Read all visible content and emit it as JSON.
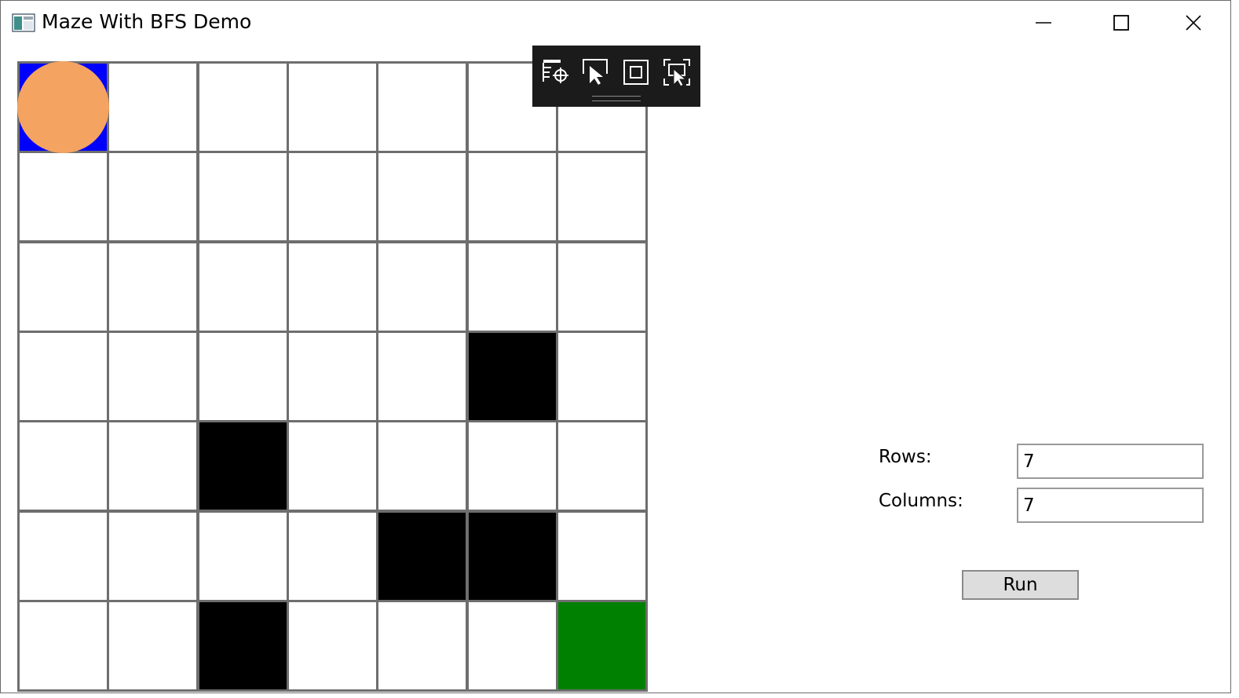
{
  "window": {
    "title": "Maze With BFS Demo",
    "minimize_icon": "minimize-icon",
    "maximize_icon": "maximize-icon",
    "close_icon": "close-icon"
  },
  "maze": {
    "rows": 7,
    "columns": 7,
    "colors": {
      "empty": "#ffffff",
      "wall": "#000000",
      "start": "#0000ff",
      "goal": "#008000",
      "agent": "#f4a460",
      "grid_line": "#6e6e6e"
    },
    "cells": [
      [
        "start",
        "empty",
        "empty",
        "empty",
        "empty",
        "empty",
        "empty"
      ],
      [
        "empty",
        "empty",
        "empty",
        "empty",
        "empty",
        "empty",
        "empty"
      ],
      [
        "empty",
        "empty",
        "empty",
        "empty",
        "empty",
        "empty",
        "empty"
      ],
      [
        "empty",
        "empty",
        "empty",
        "empty",
        "empty",
        "wall",
        "empty"
      ],
      [
        "empty",
        "empty",
        "wall",
        "empty",
        "empty",
        "empty",
        "empty"
      ],
      [
        "empty",
        "empty",
        "empty",
        "empty",
        "wall",
        "wall",
        "empty"
      ],
      [
        "empty",
        "empty",
        "wall",
        "empty",
        "empty",
        "empty",
        "goal"
      ]
    ],
    "agent_position": {
      "row": 0,
      "col": 0
    }
  },
  "debug_toolbar": {
    "buttons": [
      {
        "name": "select-element-icon"
      },
      {
        "name": "select-cursor-icon"
      },
      {
        "name": "display-layout-adorners-icon"
      },
      {
        "name": "track-focused-element-icon"
      }
    ]
  },
  "settings": {
    "rows_label": "Rows:",
    "rows_value": "7",
    "columns_label": "Columns:",
    "columns_value": "7",
    "run_label": "Run"
  }
}
